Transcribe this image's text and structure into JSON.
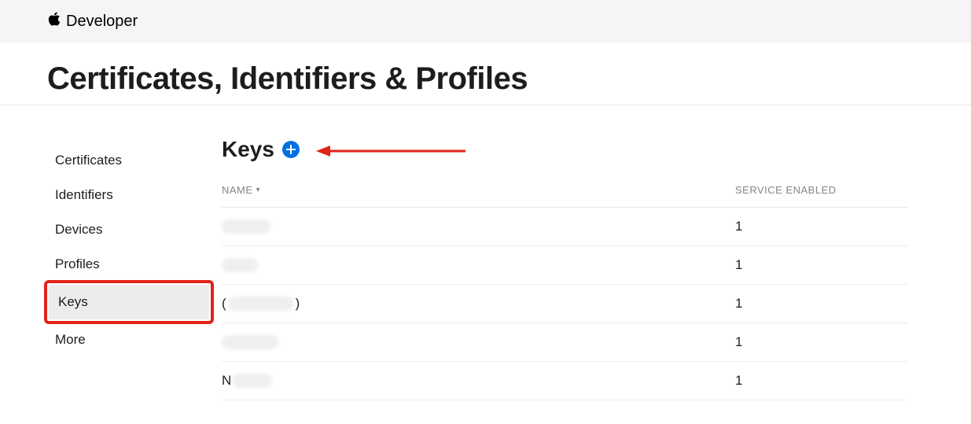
{
  "header": {
    "brand": "Developer"
  },
  "page": {
    "title": "Certificates, Identifiers & Profiles"
  },
  "sidebar": {
    "items": [
      {
        "label": "Certificates",
        "active": false
      },
      {
        "label": "Identifiers",
        "active": false
      },
      {
        "label": "Devices",
        "active": false
      },
      {
        "label": "Profiles",
        "active": false
      },
      {
        "label": "Keys",
        "active": true,
        "highlighted": true
      },
      {
        "label": "More",
        "active": false
      }
    ]
  },
  "section": {
    "title": "Keys",
    "add_icon": "plus-circle"
  },
  "table": {
    "columns": {
      "name": "NAME",
      "service": "SERVICE ENABLED"
    },
    "rows": [
      {
        "name_redacted": true,
        "letter": "",
        "service_enabled": "1"
      },
      {
        "name_redacted": true,
        "letter": "",
        "service_enabled": "1"
      },
      {
        "name_redacted": true,
        "letter": "(",
        "trail": ")",
        "service_enabled": "1"
      },
      {
        "name_redacted": true,
        "letter": "",
        "service_enabled": "1"
      },
      {
        "name_redacted": true,
        "letter": "N",
        "service_enabled": "1"
      }
    ]
  },
  "annotation": {
    "type": "arrow",
    "direction": "left",
    "color": "#e2231a"
  }
}
